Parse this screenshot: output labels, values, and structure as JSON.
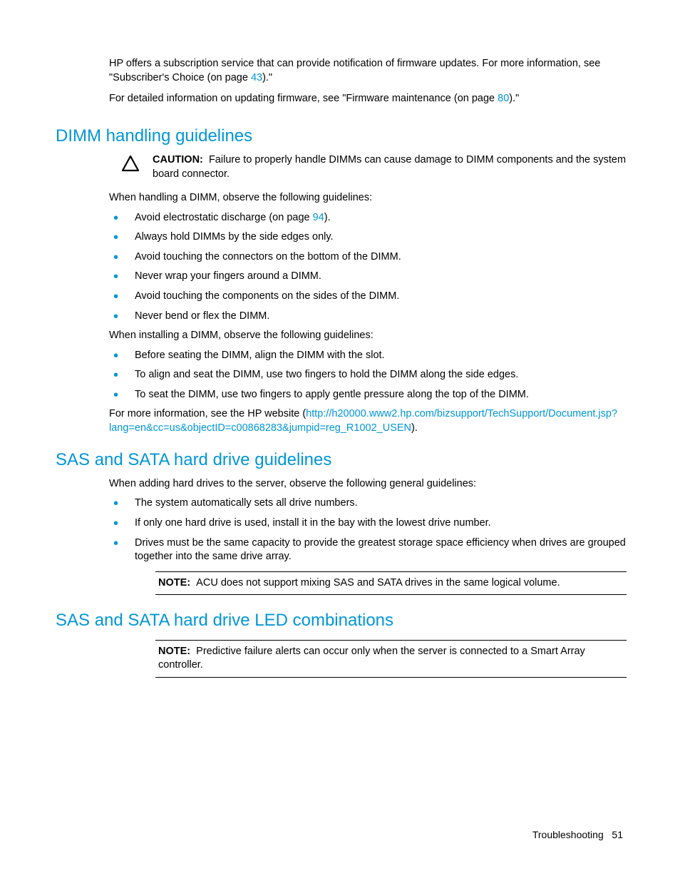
{
  "intro": {
    "p1a": "HP offers a subscription service that can provide notification of firmware updates. For more information, see \"Subscriber's Choice (on page ",
    "p1link": "43",
    "p1b": ").\"",
    "p2a": "For detailed information on updating firmware, see \"Firmware maintenance (on page ",
    "p2link": "80",
    "p2b": ").\""
  },
  "dimm": {
    "heading": "DIMM handling guidelines",
    "caution_label": "CAUTION:",
    "caution_text": "Failure to properly handle DIMMs can cause damage to DIMM components and the system board connector.",
    "para_handling": "When handling a DIMM, observe the following guidelines:",
    "bullets1_0a": "Avoid electrostatic discharge (on page ",
    "bullets1_0link": "94",
    "bullets1_0b": ").",
    "bullets1_1": "Always hold DIMMs by the side edges only.",
    "bullets1_2": "Avoid touching the connectors on the bottom of the DIMM.",
    "bullets1_3": "Never wrap your fingers around a DIMM.",
    "bullets1_4": "Avoid touching the components on the sides of the DIMM.",
    "bullets1_5": "Never bend or flex the DIMM.",
    "para_installing": "When installing a DIMM, observe the following guidelines:",
    "bullets2_0": "Before seating the DIMM, align the DIMM with the slot.",
    "bullets2_1": "To align and seat the DIMM, use two fingers to hold the DIMM along the side edges.",
    "bullets2_2": "To seat the DIMM, use two fingers to apply gentle pressure along the top of the DIMM.",
    "more_a": "For more information, see the HP website (",
    "more_link": "http://h20000.www2.hp.com/bizsupport/TechSupport/Document.jsp?lang=en&cc=us&objectID=c00868283&jumpid=reg_R1002_USEN",
    "more_b": ")."
  },
  "sas": {
    "heading": "SAS and SATA hard drive guidelines",
    "para": "When adding hard drives to the server, observe the following general guidelines:",
    "bullets_0": "The system automatically sets all drive numbers.",
    "bullets_1": "If only one hard drive is used, install it in the bay with the lowest drive number.",
    "bullets_2": "Drives must be the same capacity to provide the greatest storage space efficiency when drives are grouped together into the same drive array.",
    "note_label": "NOTE:",
    "note_text": "ACU does not support mixing SAS and SATA drives in the same logical volume."
  },
  "led": {
    "heading": "SAS and SATA hard drive LED combinations",
    "note_label": "NOTE:",
    "note_text": "Predictive failure alerts can occur only when the server is connected to a Smart Array controller."
  },
  "footer": {
    "section": "Troubleshooting",
    "page": "51"
  }
}
